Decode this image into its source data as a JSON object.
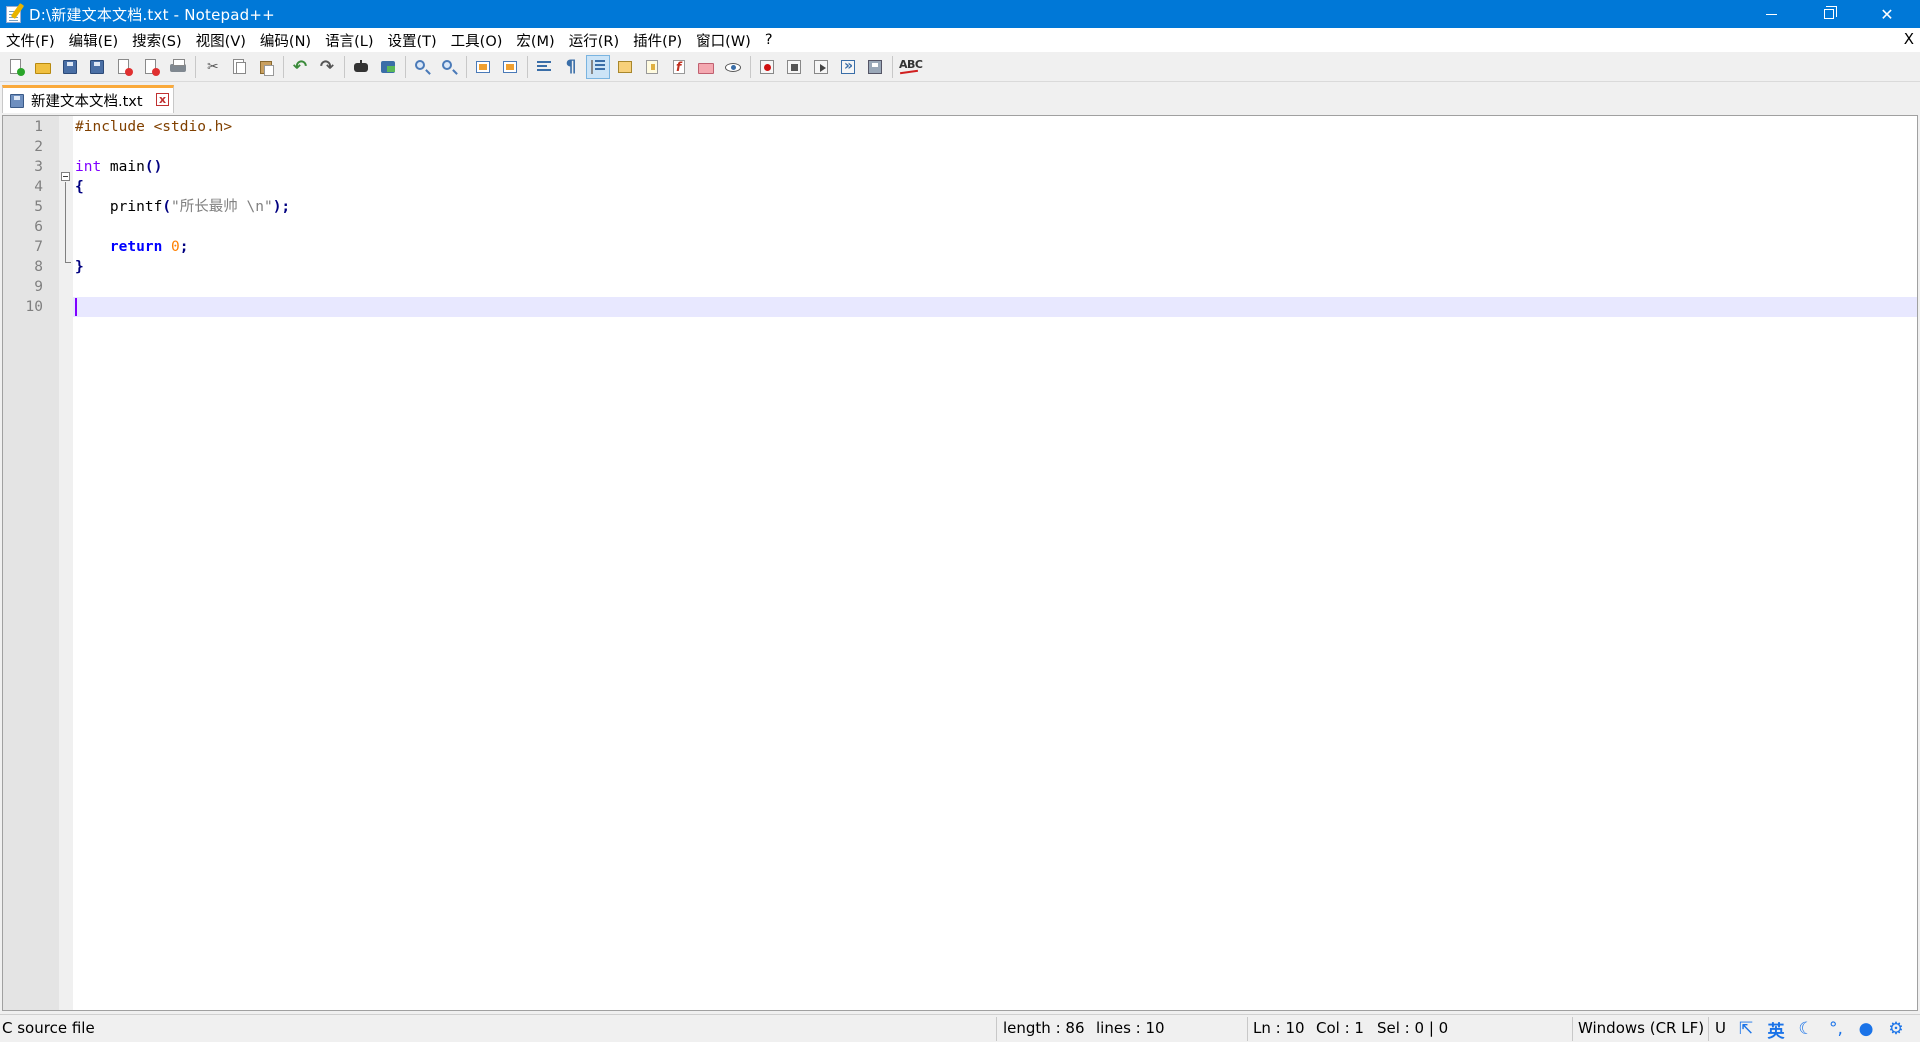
{
  "window": {
    "title": "D:\\新建文本文档.txt - Notepad++",
    "close_doc": "X"
  },
  "menu": [
    "文件(F)",
    "编辑(E)",
    "搜索(S)",
    "视图(V)",
    "编码(N)",
    "语言(L)",
    "设置(T)",
    "工具(O)",
    "宏(M)",
    "运行(R)",
    "插件(P)",
    "窗口(W)",
    "?"
  ],
  "toolbar": {
    "buttons": [
      "new-file",
      "open-file",
      "save",
      "save-all",
      "close",
      "close-all",
      "print",
      "cut",
      "copy",
      "paste",
      "undo",
      "redo",
      "find",
      "replace",
      "zoom-in",
      "zoom-out",
      "sync-vertical",
      "sync-horizontal",
      "word-wrap",
      "show-all-characters",
      "indent-guide",
      "document-map",
      "document-list",
      "function-list",
      "folder-as-workspace",
      "monitoring",
      "start-recording",
      "stop-recording",
      "playback",
      "run-macro-multiple",
      "save-macro",
      "spell-check"
    ],
    "pressed": "indent-guide",
    "spell_label": "ABC"
  },
  "tab": {
    "label": "新建文本文档.txt",
    "close": "x"
  },
  "editor": {
    "line_numbers": [
      "1",
      "2",
      "3",
      "4",
      "5",
      "6",
      "7",
      "8",
      "9",
      "10"
    ],
    "lines": [
      [
        {
          "t": "#include <stdio.h>",
          "c": "pre"
        }
      ],
      [],
      [
        {
          "t": "int",
          "c": "type"
        },
        {
          "t": " main",
          "c": "def"
        },
        {
          "t": "()",
          "c": "op"
        }
      ],
      [
        {
          "t": "{",
          "c": "op"
        }
      ],
      [
        {
          "t": "    printf",
          "c": "def"
        },
        {
          "t": "(",
          "c": "op"
        },
        {
          "t": "\"所长最帅 \\n\"",
          "c": "str"
        },
        {
          "t": ");",
          "c": "op"
        }
      ],
      [],
      [
        {
          "t": "    ",
          "c": "def"
        },
        {
          "t": "return",
          "c": "word"
        },
        {
          "t": " ",
          "c": "def"
        },
        {
          "t": "0",
          "c": "num"
        },
        {
          "t": ";",
          "c": "op"
        }
      ],
      [
        {
          "t": "}",
          "c": "op"
        }
      ],
      [],
      []
    ],
    "current_line": 10
  },
  "status": {
    "file_type": "C source file",
    "length": "length : 86",
    "lines": "lines : 10",
    "ln": "Ln : 10",
    "col": "Col : 1",
    "sel": "Sel : 0 | 0",
    "eol": "Windows (CR LF)",
    "encoding": "U"
  },
  "tray": {
    "ime_label": "英"
  }
}
